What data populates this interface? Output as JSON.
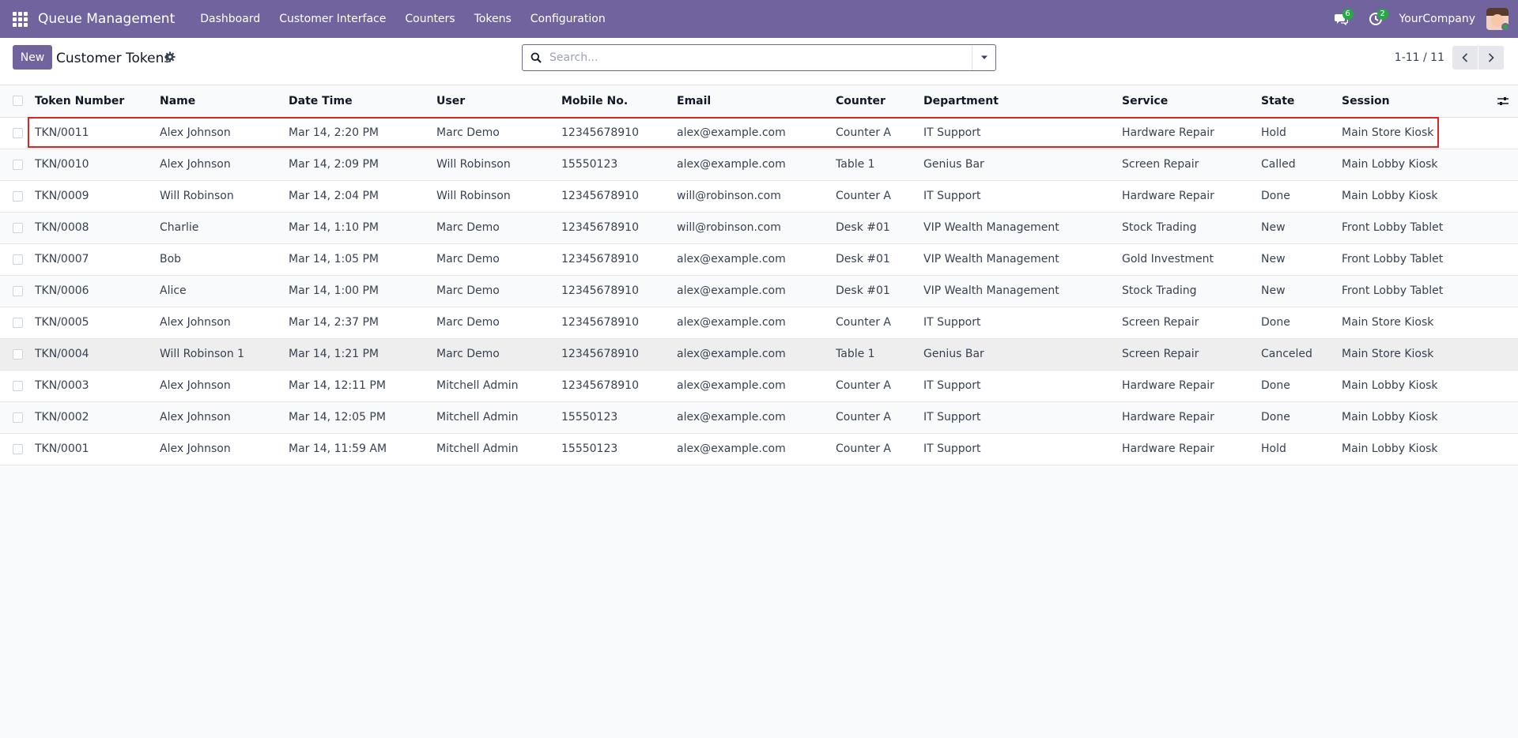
{
  "navbar": {
    "app_name": "Queue Management",
    "menu": [
      "Dashboard",
      "Customer Interface",
      "Counters",
      "Tokens",
      "Configuration"
    ],
    "messages_badge": "6",
    "activities_badge": "2",
    "company": "YourCompany",
    "color": "#71639e"
  },
  "control_panel": {
    "new_button": "New",
    "title": "Customer Tokens",
    "search_placeholder": "Search...",
    "pager": "1-11 / 11"
  },
  "table": {
    "columns": [
      "Token Number",
      "Name",
      "Date Time",
      "User",
      "Mobile No.",
      "Email",
      "Counter",
      "Department",
      "Service",
      "State",
      "Session"
    ],
    "rows": [
      [
        "TKN/0011",
        "Alex Johnson",
        "Mar 14, 2:20 PM",
        "Marc Demo",
        "12345678910",
        "alex@example.com",
        "Counter A",
        "IT Support",
        "Hardware Repair",
        "Hold",
        "Main Store Kiosk"
      ],
      [
        "TKN/0010",
        "Alex Johnson",
        "Mar 14, 2:09 PM",
        "Will Robinson",
        "15550123",
        "alex@example.com",
        "Table 1",
        "Genius Bar",
        "Screen Repair",
        "Called",
        "Main Lobby Kiosk"
      ],
      [
        "TKN/0009",
        "Will Robinson",
        "Mar 14, 2:04 PM",
        "Will Robinson",
        "12345678910",
        "will@robinson.com",
        "Counter A",
        "IT Support",
        "Hardware Repair",
        "Done",
        "Main Lobby Kiosk"
      ],
      [
        "TKN/0008",
        "Charlie",
        "Mar 14, 1:10 PM",
        "Marc Demo",
        "12345678910",
        "will@robinson.com",
        "Desk #01",
        "VIP Wealth Management",
        "Stock Trading",
        "New",
        "Front Lobby Tablet"
      ],
      [
        "TKN/0007",
        "Bob",
        "Mar 14, 1:05 PM",
        "Marc Demo",
        "12345678910",
        "alex@example.com",
        "Desk #01",
        "VIP Wealth Management",
        "Gold Investment",
        "New",
        "Front Lobby Tablet"
      ],
      [
        "TKN/0006",
        "Alice",
        "Mar 14, 1:00 PM",
        "Marc Demo",
        "12345678910",
        "alex@example.com",
        "Desk #01",
        "VIP Wealth Management",
        "Stock Trading",
        "New",
        "Front Lobby Tablet"
      ],
      [
        "TKN/0005",
        "Alex Johnson",
        "Mar 14, 2:37 PM",
        "Marc Demo",
        "12345678910",
        "alex@example.com",
        "Counter A",
        "IT Support",
        "Screen Repair",
        "Done",
        "Main Store Kiosk"
      ],
      [
        "TKN/0004",
        "Will Robinson 1",
        "Mar 14, 1:21 PM",
        "Marc Demo",
        "12345678910",
        "alex@example.com",
        "Table 1",
        "Genius Bar",
        "Screen Repair",
        "Canceled",
        "Main Store Kiosk"
      ],
      [
        "TKN/0003",
        "Alex Johnson",
        "Mar 14, 12:11 PM",
        "Mitchell Admin",
        "12345678910",
        "alex@example.com",
        "Counter A",
        "IT Support",
        "Hardware Repair",
        "Done",
        "Main Lobby Kiosk"
      ],
      [
        "TKN/0002",
        "Alex Johnson",
        "Mar 14, 12:05 PM",
        "Mitchell Admin",
        "15550123",
        "alex@example.com",
        "Counter A",
        "IT Support",
        "Hardware Repair",
        "Done",
        "Main Lobby Kiosk"
      ],
      [
        "TKN/0001",
        "Alex Johnson",
        "Mar 14, 11:59 AM",
        "Mitchell Admin",
        "15550123",
        "alex@example.com",
        "Counter A",
        "IT Support",
        "Hardware Repair",
        "Hold",
        "Main Lobby Kiosk"
      ]
    ],
    "highlight_color": "#e02424"
  }
}
